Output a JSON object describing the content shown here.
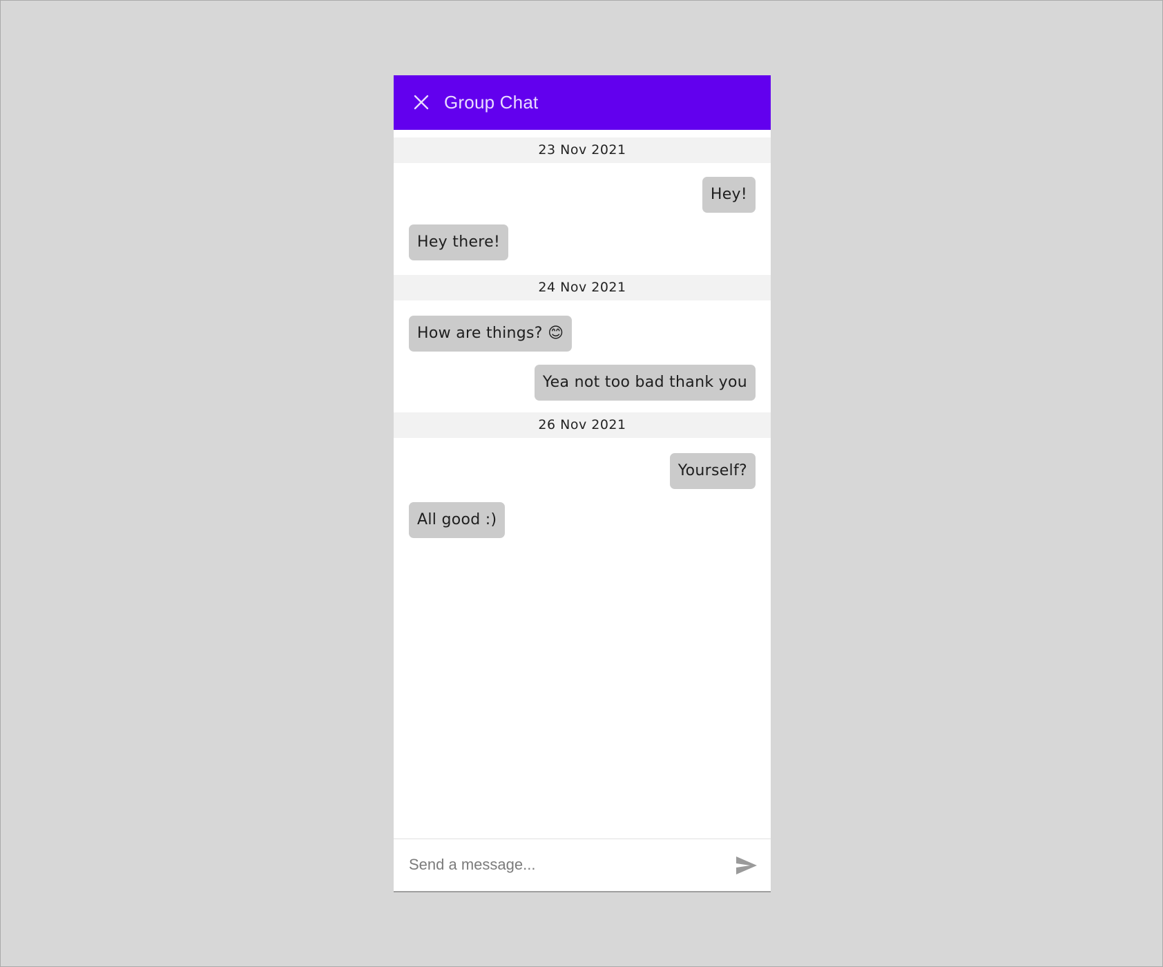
{
  "header": {
    "title": "Group Chat",
    "close_icon": "close-icon",
    "background": "#6200ee"
  },
  "days": [
    {
      "date": "23 Nov 2021"
    },
    {
      "date": "24 Nov 2021"
    },
    {
      "date": "26 Nov 2021"
    }
  ],
  "messages": [
    {
      "text": "Hey!",
      "side": "right"
    },
    {
      "text": "Hey there!",
      "side": "left"
    },
    {
      "text": "How are things? 😊",
      "side": "left"
    },
    {
      "text": "Yea not too bad thank you",
      "side": "right"
    },
    {
      "text": "Yourself?",
      "side": "right"
    },
    {
      "text": "All good :)",
      "side": "left"
    }
  ],
  "composer": {
    "placeholder": "Send a message...",
    "send_icon": "send-icon"
  },
  "colors": {
    "accent": "#6200ee",
    "bubble": "#cbcbcb",
    "divider_bg": "#f2f2f2",
    "page_bg": "#d7d7d7"
  }
}
